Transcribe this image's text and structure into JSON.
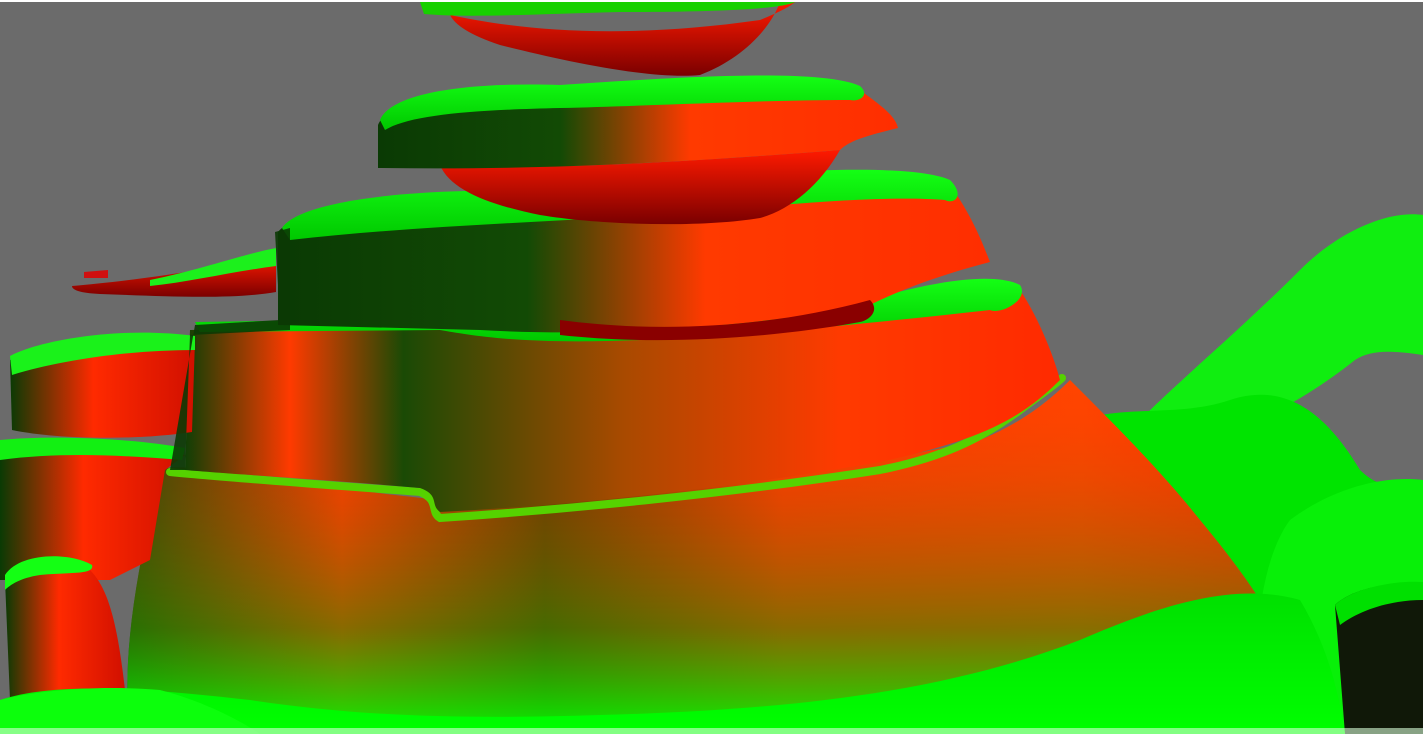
{
  "colors": {
    "sky": "#6b6b6b",
    "terrain_light": "#00ff00",
    "terrain_dark": "#0a2a06",
    "cliff_red": "#ff3a00",
    "cliff_dark_red": "#b00000",
    "frame_top": "#ffffff"
  },
  "scene": {
    "kind": "3d-terrain-viewport",
    "has_text": false
  }
}
